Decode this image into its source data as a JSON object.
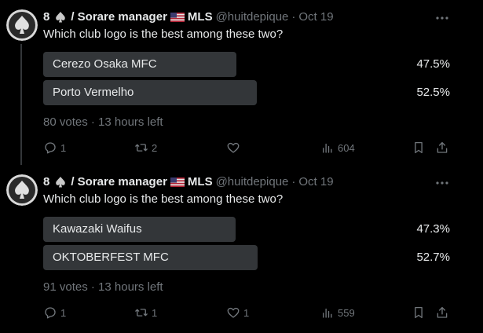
{
  "tweets": [
    {
      "author": {
        "name_prefix": "8",
        "name_suffix": "/ Sorare manager",
        "name_tail": "MLS",
        "handle": "@huitdepique",
        "separator": "·",
        "time": "Oct 19"
      },
      "question": "Which club logo is the best among these two?",
      "options": [
        {
          "label": "Cerezo Osaka MFC",
          "percent_text": "47.5%",
          "percent": 47.5,
          "winner": false
        },
        {
          "label": "Porto Vermelho",
          "percent_text": "52.5%",
          "percent": 52.5,
          "winner": true
        }
      ],
      "meta": "80 votes · 13 hours left",
      "actions": {
        "replies": "1",
        "reposts": "2",
        "likes": "",
        "views": "604"
      }
    },
    {
      "author": {
        "name_prefix": "8",
        "name_suffix": "/ Sorare manager",
        "name_tail": "MLS",
        "handle": "@huitdepique",
        "separator": "·",
        "time": "Oct 19"
      },
      "question": "Which club logo is the best among these two?",
      "options": [
        {
          "label": "Kawazaki Waifus",
          "percent_text": "47.3%",
          "percent": 47.3,
          "winner": false
        },
        {
          "label": "OKTOBERFEST MFC",
          "percent_text": "52.7%",
          "percent": 52.7,
          "winner": true
        }
      ],
      "meta": "91 votes · 13 hours left",
      "actions": {
        "replies": "1",
        "reposts": "1",
        "likes": "1",
        "views": "559"
      }
    }
  ],
  "colors": {
    "background": "#000000",
    "text": "#e7e9ea",
    "muted": "#71767b",
    "bar": "#333639"
  }
}
